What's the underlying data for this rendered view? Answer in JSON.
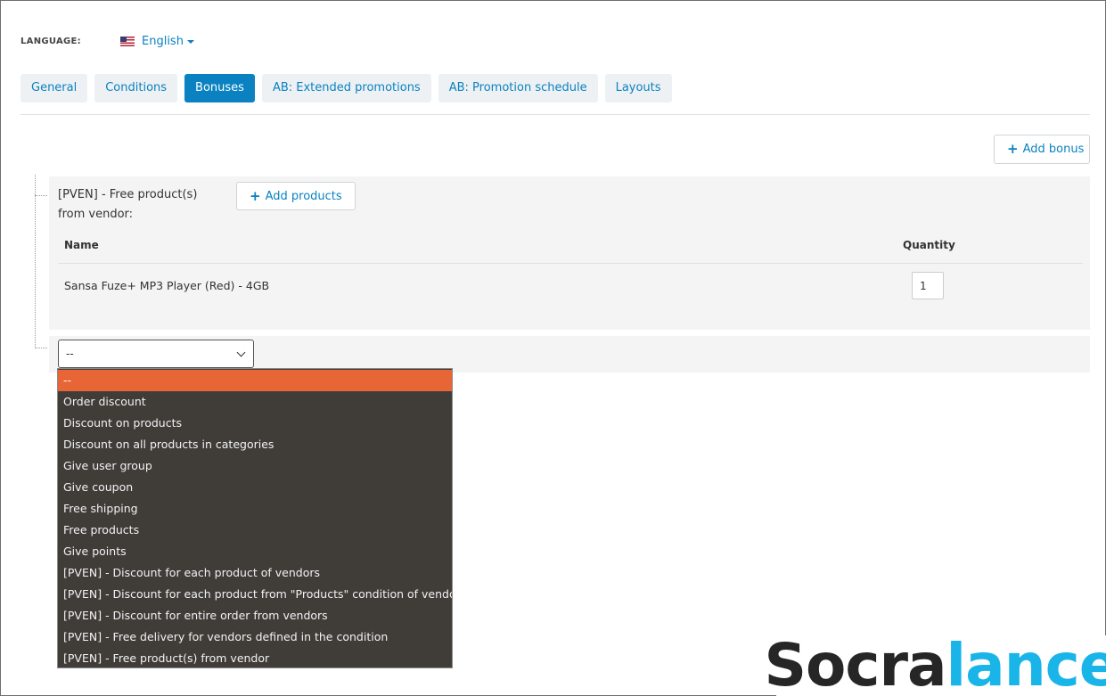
{
  "language": {
    "label": "LANGUAGE:",
    "value": "English",
    "flag_icon": "us-flag-icon"
  },
  "tabs": [
    {
      "label": "General",
      "active": false
    },
    {
      "label": "Conditions",
      "active": false
    },
    {
      "label": "Bonuses",
      "active": true
    },
    {
      "label": "AB: Extended promotions",
      "active": false
    },
    {
      "label": "AB: Promotion schedule",
      "active": false
    },
    {
      "label": "Layouts",
      "active": false
    }
  ],
  "add_bonus_label": "Add bonus",
  "bonus": {
    "title": "[PVEN] - Free product(s) from vendor:",
    "add_products_label": "Add products",
    "columns": {
      "name": "Name",
      "quantity": "Quantity"
    },
    "rows": [
      {
        "name": "Sansa Fuze+ MP3 Player (Red) - 4GB",
        "quantity": "1"
      }
    ]
  },
  "bonus_select": {
    "value": "--",
    "options": [
      "--",
      "Order discount",
      "Discount on products",
      "Discount on all products in categories",
      "Give user group",
      "Give coupon",
      "Free shipping",
      "Free products",
      "Give points",
      "[PVEN] - Discount for each product of vendors",
      "[PVEN] - Discount for each product from \"Products\" condition of vendors",
      "[PVEN] - Discount for entire order from vendors",
      "[PVEN] - Free delivery for vendors defined in the condition",
      "[PVEN] - Free product(s) from vendor"
    ]
  },
  "watermark": {
    "part1": "Socra",
    "part2": "lance"
  },
  "colors": {
    "accent": "#0a82c2",
    "selected_option": "#e86635",
    "dropdown_bg": "#403d39",
    "watermark_blue": "#19b5e8"
  }
}
